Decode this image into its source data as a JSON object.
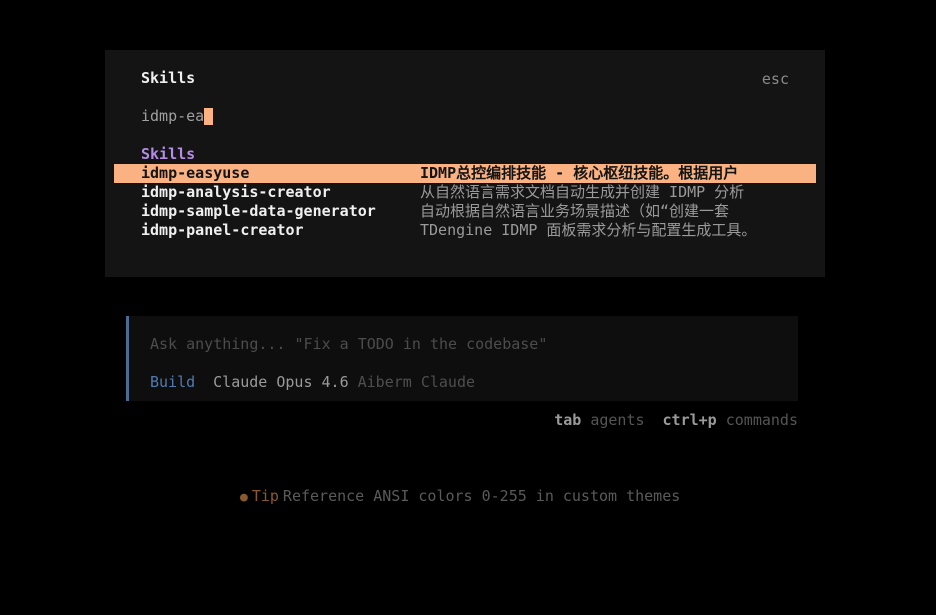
{
  "dialog": {
    "title": "Skills",
    "close_hint": "esc",
    "search_value": "idmp-ea",
    "group_label": "Skills",
    "items": [
      {
        "name": "idmp-easyuse",
        "description": "IDMP总控编排技能 - 核心枢纽技能。根据用户",
        "selected": true
      },
      {
        "name": "idmp-analysis-creator",
        "description": "从自然语言需求文档自动生成并创建 IDMP 分析",
        "selected": false
      },
      {
        "name": "idmp-sample-data-generator",
        "description": "自动根据自然语言业务场景描述（如“创建一套",
        "selected": false
      },
      {
        "name": "idmp-panel-creator",
        "description": "TDengine IDMP 面板需求分析与配置生成工具。",
        "selected": false
      }
    ]
  },
  "prompt": {
    "placeholder": "Ask anything... \"Fix a TODO in the codebase\"",
    "mode": "Build",
    "model": "Claude Opus 4.6",
    "provider": "Aiberm Claude"
  },
  "hints": {
    "agents_key": "tab",
    "agents_label": "agents",
    "commands_key": "ctrl+p",
    "commands_label": "commands"
  },
  "tip": {
    "bullet": "●",
    "label": "Tip",
    "text": "Reference ANSI colors 0-255 in custom themes"
  },
  "colors": {
    "accent": "#fab283",
    "group_label": "#b48ce6",
    "mode": "#4f7ab0",
    "tip": "#8a5a2e"
  }
}
